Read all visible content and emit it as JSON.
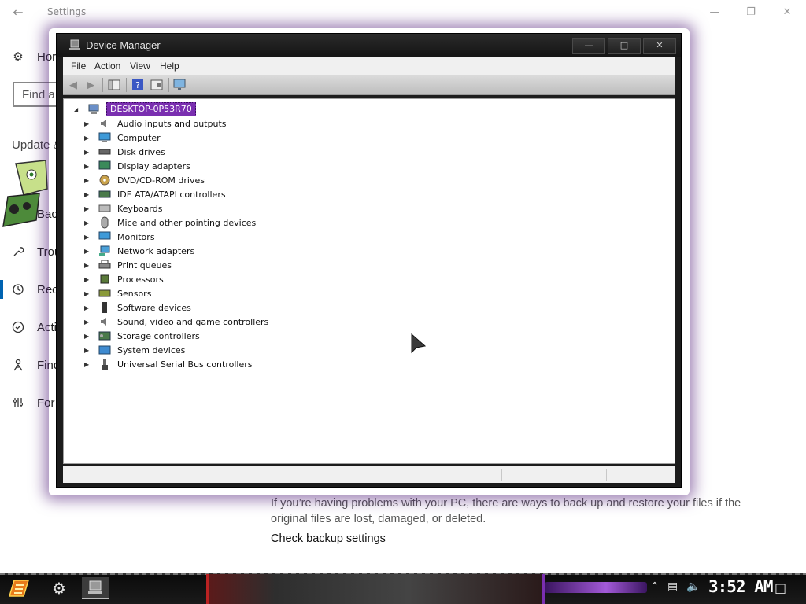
{
  "settings": {
    "title": "Settings",
    "search_placeholder": "Find a",
    "section": "Update &",
    "nav": [
      {
        "label": "Hor",
        "icon": "gear-icon"
      },
      {
        "label": "Bac",
        "icon": "backup-icon"
      },
      {
        "label": "Trou",
        "icon": "wrench-icon"
      },
      {
        "label": "Rec",
        "icon": "history-icon"
      },
      {
        "label": "Acti",
        "icon": "check-circle-icon"
      },
      {
        "label": "Find",
        "icon": "person-icon"
      },
      {
        "label": "For",
        "icon": "developer-icon"
      }
    ],
    "description": "If you’re having problems with your PC, there are ways to back up and restore your files if the original files are lost, damaged, or deleted.",
    "link": "Check backup settings"
  },
  "device_manager": {
    "title": "Device Manager",
    "menu": [
      "File",
      "Action",
      "View",
      "Help"
    ],
    "computer_name": "DESKTOP-0P53R70",
    "categories": [
      {
        "label": "Audio inputs and outputs",
        "icon": "speaker-icon"
      },
      {
        "label": "Computer",
        "icon": "computer-icon"
      },
      {
        "label": "Disk drives",
        "icon": "disk-drive-icon"
      },
      {
        "label": "Display adapters",
        "icon": "display-adapter-icon"
      },
      {
        "label": "DVD/CD-ROM drives",
        "icon": "dvd-drive-icon"
      },
      {
        "label": "IDE ATA/ATAPI controllers",
        "icon": "ide-controller-icon"
      },
      {
        "label": "Keyboards",
        "icon": "keyboard-icon"
      },
      {
        "label": "Mice and other pointing devices",
        "icon": "mouse-icon"
      },
      {
        "label": "Monitors",
        "icon": "monitor-icon"
      },
      {
        "label": "Network adapters",
        "icon": "network-adapter-icon"
      },
      {
        "label": "Print queues",
        "icon": "printer-icon"
      },
      {
        "label": "Processors",
        "icon": "processor-icon"
      },
      {
        "label": "Sensors",
        "icon": "sensor-icon"
      },
      {
        "label": "Software devices",
        "icon": "software-device-icon"
      },
      {
        "label": "Sound, video and game controllers",
        "icon": "speaker-icon"
      },
      {
        "label": "Storage controllers",
        "icon": "storage-controller-icon"
      },
      {
        "label": "System devices",
        "icon": "system-devices-icon"
      },
      {
        "label": "Universal Serial Bus controllers",
        "icon": "usb-icon"
      }
    ]
  },
  "taskbar": {
    "clock": "3:52 AM"
  },
  "colors": {
    "accent_purple": "#7a2fb0",
    "settings_accent": "#0063b1"
  }
}
